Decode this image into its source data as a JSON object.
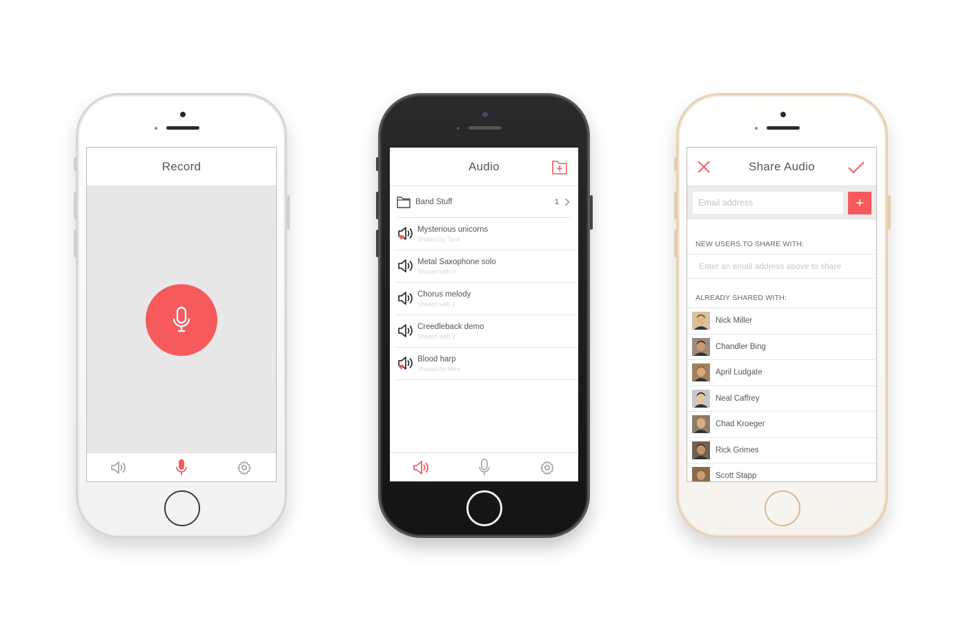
{
  "colors": {
    "accent": "#f65a5c",
    "tab_inactive": "#9a9a9a"
  },
  "record_screen": {
    "title": "Record",
    "record_button_icon": "microphone-icon",
    "tabs": [
      "speaker-icon",
      "microphone-icon",
      "gear-icon"
    ],
    "active_tab": 1
  },
  "audio_screen": {
    "title": "Audio",
    "add_folder_icon": "add-folder-icon",
    "folder": {
      "name": "Band Stuff",
      "count": "1"
    },
    "items": [
      {
        "title": "Mysterious unicorns",
        "subtitle": "Shared by Tara",
        "shared": true
      },
      {
        "title": "Metal Saxophone solo",
        "subtitle": "Shared with 0",
        "shared": false
      },
      {
        "title": "Chorus melody",
        "subtitle": "Shared with 2",
        "shared": false
      },
      {
        "title": "Creedleback demo",
        "subtitle": "Shared with 2",
        "shared": false
      },
      {
        "title": "Blood harp",
        "subtitle": "Shared by Mike",
        "shared": true
      }
    ],
    "tabs": [
      "speaker-icon",
      "microphone-icon",
      "gear-icon"
    ],
    "active_tab": 0
  },
  "share_screen": {
    "title": "Share Audio",
    "email_placeholder": "Email address",
    "add_button": "+",
    "new_users_label": "NEW USERS TO SHARE WITH:",
    "new_users_empty": "Enter an email address above to share",
    "already_shared_label": "ALREADY SHARED WITH:",
    "contacts": [
      {
        "name": "Nick Miller"
      },
      {
        "name": "Chandler Bing"
      },
      {
        "name": "April Ludgate"
      },
      {
        "name": "Neal Caffrey"
      },
      {
        "name": "Chad Kroeger"
      },
      {
        "name": "Rick Grimes"
      },
      {
        "name": "Scott Stapp"
      }
    ]
  }
}
